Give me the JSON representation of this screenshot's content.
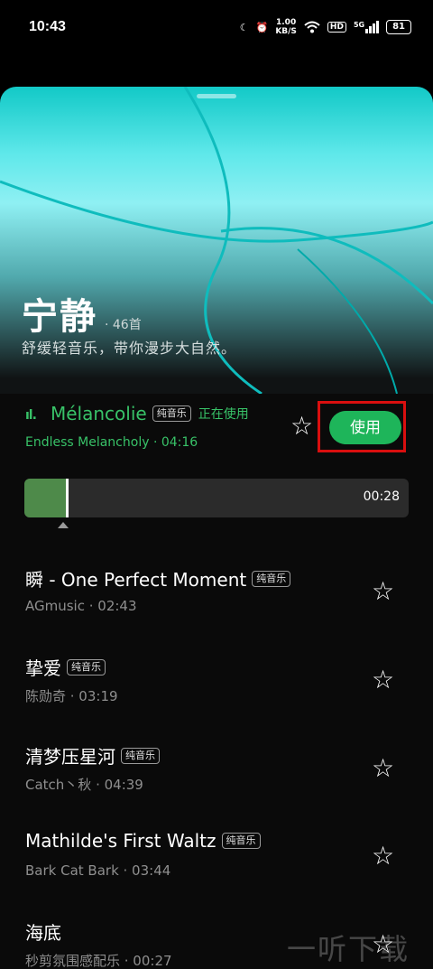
{
  "status": {
    "time": "10:43",
    "speed_value": "1.00",
    "speed_unit": "KB/S",
    "hd": "HD",
    "signal": "5G",
    "battery": "81"
  },
  "playlist": {
    "title": "宁静",
    "count": "· 46首",
    "subtitle": "舒缓轻音乐，带你漫步大自然。"
  },
  "current": {
    "eq_icon": "ıl.",
    "title": "Mélancolie",
    "tag": "纯音乐",
    "status": "正在使用",
    "meta": "Endless Melancholy · 04:16",
    "use_label": "使用",
    "progress_time": "00:28",
    "progress_fraction": 0.11
  },
  "songs": [
    {
      "name": "瞬 - One Perfect Moment",
      "tag": "纯音乐",
      "meta": "AGmusic · 02:43"
    },
    {
      "name": "挚爱",
      "tag": "纯音乐",
      "meta": "陈勋奇 · 03:19"
    },
    {
      "name": "清梦压星河",
      "tag": "纯音乐",
      "meta": "Catch丶秋 · 04:39"
    },
    {
      "name": "Mathilde's First Waltz",
      "tag": "纯音乐",
      "meta": "Bark Cat Bark · 03:44"
    },
    {
      "name": "海底",
      "tag": "",
      "meta": "秒剪氛围感配乐 · 00:27"
    }
  ],
  "icons": {
    "star": "☆",
    "moon": "☾",
    "alarm": "⏰"
  },
  "watermark": "一听下载",
  "colors": {
    "accent": "#38c268",
    "button": "#1eb55a",
    "highlight": "#d90f0f"
  }
}
